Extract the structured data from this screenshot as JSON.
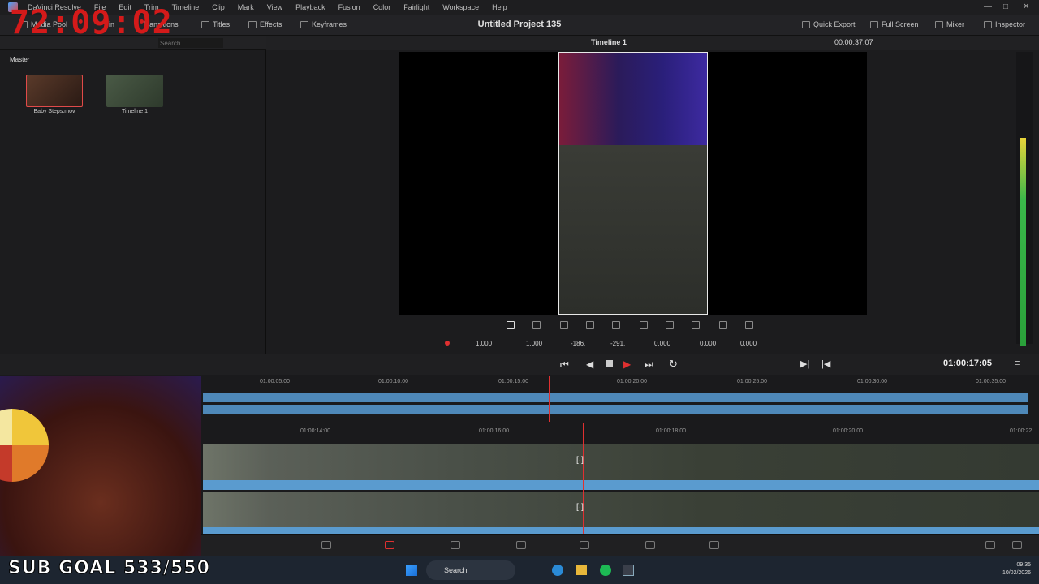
{
  "menubar": {
    "app_name": "DaVinci Resolve",
    "items": [
      "File",
      "Edit",
      "Trim",
      "Timeline",
      "Clip",
      "Mark",
      "View",
      "Playback",
      "Fusion",
      "Color",
      "Fairlight",
      "Workspace",
      "Help"
    ]
  },
  "toolbar": {
    "media_pool": "Media Pool",
    "sync_bin": "Bin",
    "transitions": "Transitions",
    "titles": "Titles",
    "effects": "Effects",
    "keyframes": "Keyframes",
    "project_title": "Untitled Project 135",
    "quick_export": "Quick Export",
    "full_screen": "Full Screen",
    "mixer": "Mixer",
    "inspector": "Inspector"
  },
  "media_pool": {
    "search_placeholder": "Search",
    "master_label": "Master",
    "items": [
      {
        "label": "Baby Steps.mov"
      },
      {
        "label": "Timeline 1"
      }
    ]
  },
  "viewer": {
    "timeline_name": "Timeline 1",
    "source_timecode": "00:00:37:07",
    "zoom_x": "1.000",
    "zoom_y": "1.000",
    "pos_x": "-186.",
    "pos_y": "-291.",
    "rotation": "0.000",
    "pitch": "0.000",
    "yaw": "0.000"
  },
  "transport": {
    "timecode": "01:00:17:05"
  },
  "timeline": {
    "ruler_upper": [
      "01:00:05:00",
      "01:00:10:00",
      "01:00:15:00",
      "01:00:20:00",
      "01:00:25:00",
      "01:00:30:00",
      "01:00:35:00"
    ],
    "ruler_lower": [
      "01:00:14:00",
      "01:00:16:00",
      "01:00:18:00",
      "01:00:20:00",
      "01:00:22"
    ]
  },
  "taskbar": {
    "search_label": "Search",
    "time": "09:35",
    "date": "10/02/2026"
  },
  "overlay": {
    "timer": "72:09:02",
    "sub_goal": "SUB GOAL 533/550"
  },
  "colors": {
    "accent_red": "#e03030",
    "clip_blue": "#4e88b8",
    "bg_dark": "#1c1c1e"
  }
}
